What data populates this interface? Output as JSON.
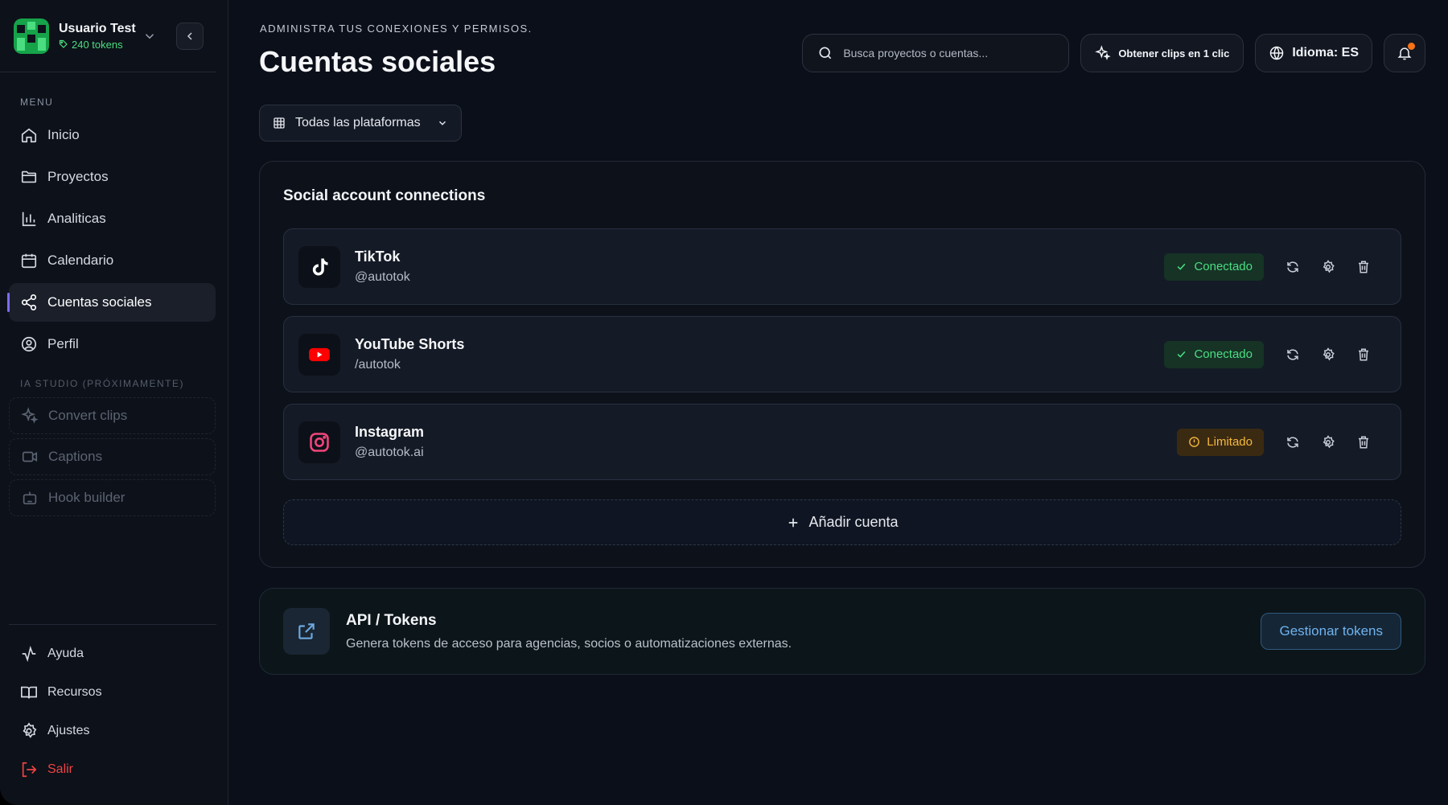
{
  "user": {
    "name": "Usuario Test",
    "tokens": "240 tokens"
  },
  "sidebar": {
    "menu_label": "MENU",
    "items": [
      {
        "label": "Inicio",
        "icon": "home-icon"
      },
      {
        "label": "Proyectos",
        "icon": "folder-icon"
      },
      {
        "label": "Analiticas",
        "icon": "bar-chart-icon"
      },
      {
        "label": "Calendario",
        "icon": "calendar-icon"
      },
      {
        "label": "Cuentas sociales",
        "icon": "share-icon",
        "active": true
      },
      {
        "label": "Perfil",
        "icon": "user-circle-icon"
      }
    ],
    "ia_label": "IA STUDIO (PRÓXIMAMENTE)",
    "soon_items": [
      {
        "label": "Convert clips",
        "icon": "sparkles-icon"
      },
      {
        "label": "Captions",
        "icon": "video-icon"
      },
      {
        "label": "Hook builder",
        "icon": "bot-icon"
      }
    ],
    "bottom_items": [
      {
        "label": "Ayuda",
        "icon": "activity-icon"
      },
      {
        "label": "Recursos",
        "icon": "book-icon"
      },
      {
        "label": "Ajustes",
        "icon": "gear-icon"
      },
      {
        "label": "Salir",
        "icon": "logout-icon"
      }
    ]
  },
  "header": {
    "eyebrow": "ADMINISTRA TUS CONEXIONES Y PERMISOS.",
    "title": "Cuentas sociales",
    "search_placeholder": "Busca proyectos o cuentas...",
    "clips_button": "Obtener clips en 1 clic",
    "language_button": "Idioma: ES"
  },
  "filter": {
    "label": "Todas las plataformas"
  },
  "connections": {
    "title": "Social account connections",
    "accounts": [
      {
        "name": "TikTok",
        "handle": "@autotok",
        "status": "Conectado",
        "status_type": "ok",
        "icon": "tiktok-icon"
      },
      {
        "name": "YouTube Shorts",
        "handle": "/autotok",
        "status": "Conectado",
        "status_type": "ok",
        "icon": "youtube-icon"
      },
      {
        "name": "Instagram",
        "handle": "@autotok.ai",
        "status": "Limitado",
        "status_type": "warn",
        "icon": "instagram-icon"
      }
    ],
    "add_label": "Añadir cuenta"
  },
  "api": {
    "title": "API / Tokens",
    "description": "Genera tokens de acceso para agencias, socios o automatizaciones externas.",
    "button": "Gestionar tokens"
  },
  "colors": {
    "accent": "#7c6cf2",
    "success": "#4ade80",
    "warning": "#f5b83d",
    "danger": "#ef4444",
    "link": "#6fb3ef"
  }
}
